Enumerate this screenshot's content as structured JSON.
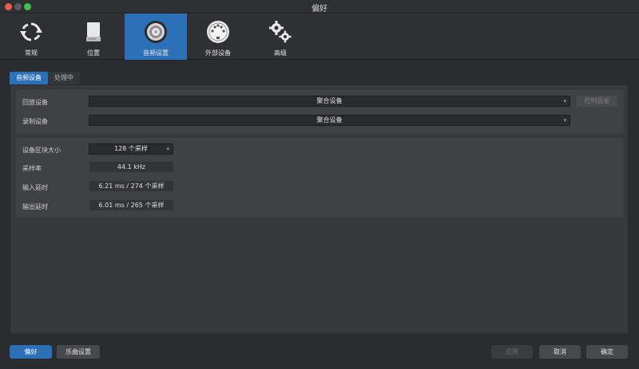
{
  "window": {
    "title": "偏好"
  },
  "toolbar": {
    "items": [
      {
        "label": "常规",
        "icon": "sync-icon"
      },
      {
        "label": "位置",
        "icon": "drive-icon"
      },
      {
        "label": "音频设置",
        "icon": "speaker-icon",
        "active": true
      },
      {
        "label": "外部设备",
        "icon": "midi-port-icon"
      },
      {
        "label": "高级",
        "icon": "gears-icon"
      }
    ]
  },
  "tabs": {
    "audio_devices": "音频设备",
    "processing": "处理中"
  },
  "devices": {
    "playback_label": "回放设备",
    "playback_value": "聚合设备",
    "control_panel": "控制面板",
    "record_label": "录制设备",
    "record_value": "聚合设备"
  },
  "settings": {
    "block_size_label": "设备区块大小",
    "block_size_value": "128 个采样",
    "sample_rate_label": "采样率",
    "sample_rate_value": "44.1 kHz",
    "input_latency_label": "输入延时",
    "input_latency_value": "6.21 ms / 274 个采样",
    "output_latency_label": "输出延时",
    "output_latency_value": "6.01 ms / 265 个采样"
  },
  "footer": {
    "preferences": "偏好",
    "song_settings": "乐曲设置",
    "apply": "应用",
    "cancel": "取消",
    "ok": "确定"
  },
  "colors": {
    "accent": "#2c71b8",
    "background": "#2b2c2f",
    "panel": "#38393c"
  }
}
